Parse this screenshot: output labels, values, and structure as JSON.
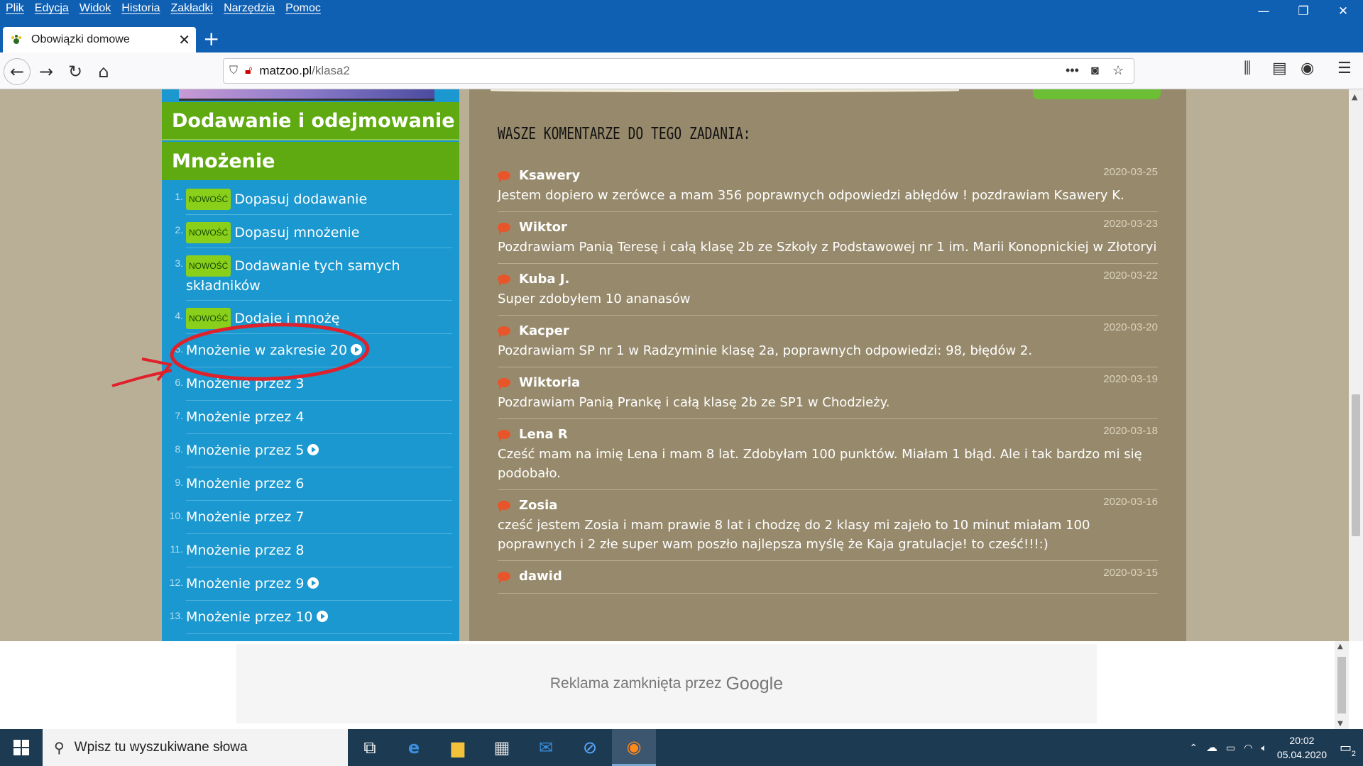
{
  "menubar": [
    "Plik",
    "Edycja",
    "Widok",
    "Historia",
    "Zakładki",
    "Narzędzia",
    "Pomoc"
  ],
  "tab": {
    "title": "Obowiązki domowe"
  },
  "url": {
    "host": "matzoo.pl",
    "path": "/klasa2"
  },
  "left_menu": {
    "section1": "Dodawanie i odejmowanie",
    "section2": "Mnożenie",
    "badge": "NOWOŚĆ",
    "items": [
      {
        "num": "1.",
        "label": "Dopasuj dodawanie"
      },
      {
        "num": "2.",
        "label": "Dopasuj mnożenie"
      },
      {
        "num": "3.",
        "label": "Dodawanie tych samych składników"
      },
      {
        "num": "4.",
        "label": "Dodaje i mnożę"
      },
      {
        "num": "5.",
        "label": "Mnożenie w zakresie 20"
      },
      {
        "num": "6.",
        "label": "Mnożenie przez 3"
      },
      {
        "num": "7.",
        "label": "Mnożenie przez 4"
      },
      {
        "num": "8.",
        "label": "Mnożenie przez 5"
      },
      {
        "num": "9.",
        "label": "Mnożenie przez 6"
      },
      {
        "num": "10.",
        "label": "Mnożenie przez 7"
      },
      {
        "num": "11.",
        "label": "Mnożenie przez 8"
      },
      {
        "num": "12.",
        "label": "Mnożenie przez 9"
      },
      {
        "num": "13.",
        "label": "Mnożenie przez 10"
      }
    ]
  },
  "comments": {
    "title": "WASZE KOMENTARZE DO TEGO ZADANIA:",
    "items": [
      {
        "author": "Ksawery",
        "date": "2020-03-25",
        "text": "Jestem dopiero w zerówce a mam 356 poprawnych odpowiedzi abłędów ! pozdrawiam Ksawery K."
      },
      {
        "author": "Wiktor",
        "date": "2020-03-23",
        "text": "Pozdrawiam Panią Teresę i całą klasę 2b ze Szkoły z Podstawowej nr 1 im. Marii Konopnickiej w Złotoryi"
      },
      {
        "author": "Kuba J.",
        "date": "2020-03-22",
        "text": "Super zdobyłem 10 ananasów"
      },
      {
        "author": "Kacper",
        "date": "2020-03-20",
        "text": "Pozdrawiam SP nr 1 w Radzyminie klasę 2a, poprawnych odpowiedzi: 98, błędów 2."
      },
      {
        "author": "Wiktoria",
        "date": "2020-03-19",
        "text": "Pozdrawiam Panią Prankę i całą klasę 2b ze SP1 w Chodzieży."
      },
      {
        "author": "Lena R",
        "date": "2020-03-18",
        "text": "Cześć mam na imię Lena i mam 8 lat. Zdobyłam 100 punktów. Miałam 1 błąd. Ale i tak bardzo mi się podobało."
      },
      {
        "author": "Zosia",
        "date": "2020-03-16",
        "text": "cześć jestem Zosia i mam prawie 8 lat i chodzę do 2 klasy mi zajeło to 10 minut miałam 100 poprawnych i 2 złe super wam poszło najlepsza myślę że Kaja gratulacje! to cześć!!!:)"
      },
      {
        "author": "dawid",
        "date": "2020-03-15",
        "text": ""
      }
    ]
  },
  "ad": {
    "text": "Reklama zamknięta przez",
    "brand": "Google"
  },
  "taskbar": {
    "search_placeholder": "Wpisz tu wyszukiwane słowa",
    "time": "20:02",
    "date": "05.04.2020",
    "notifications": "2"
  },
  "colors": {
    "chrome": "#0f5fb2",
    "menu_blue": "#1a98cf",
    "menu_green": "#5faa11",
    "comments_bg": "#978a6c",
    "annotation_red": "#e0202a"
  }
}
